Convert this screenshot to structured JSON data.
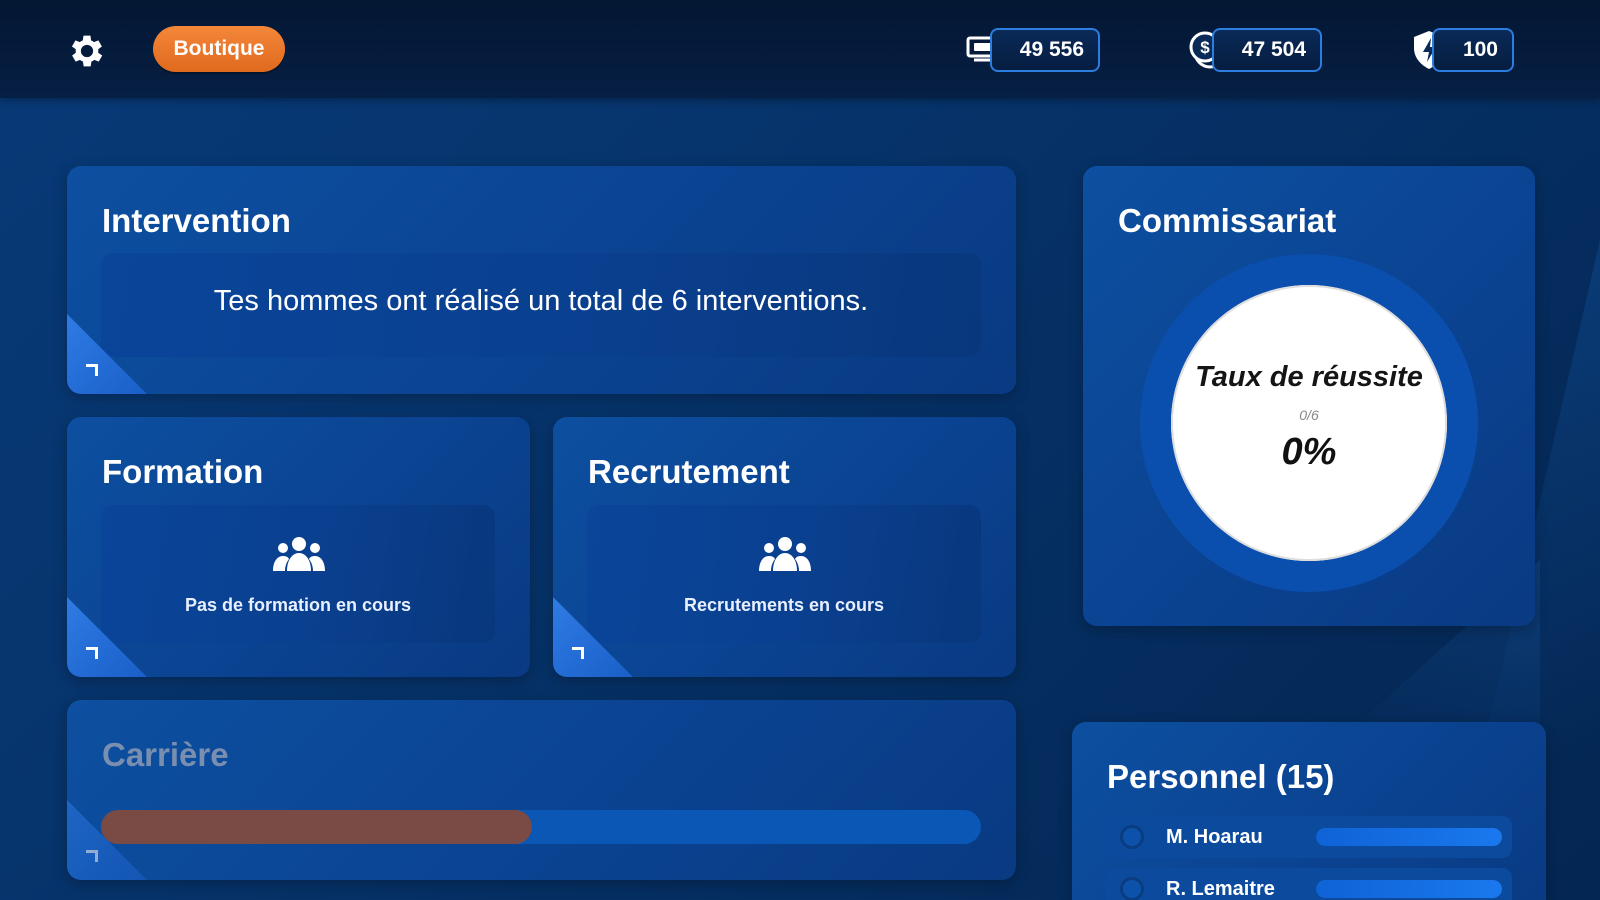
{
  "topbar": {
    "shop_label": "Boutique",
    "resources": [
      {
        "icon": "cash-icon",
        "value": "49 556"
      },
      {
        "icon": "coin-icon",
        "value": "47 504"
      },
      {
        "icon": "energy-shield-icon",
        "value": "100"
      }
    ]
  },
  "intervention": {
    "title": "Intervention",
    "text": "Tes hommes ont réalisé un total de 6 interventions."
  },
  "formation": {
    "title": "Formation",
    "status": "Pas de formation en cours"
  },
  "recrutement": {
    "title": "Recrutement",
    "status": "Recrutements en cours"
  },
  "carriere": {
    "title": "Carrière",
    "progress_fraction": 0.49
  },
  "commissariat": {
    "title": "Commissariat",
    "success_label": "Taux de réussite",
    "ratio": "0/6",
    "percent": "0%"
  },
  "personnel": {
    "title": "Personnel (15)",
    "members": [
      {
        "name": "M. Hoarau",
        "level_fraction": 1.0
      },
      {
        "name": "R. Lemaitre",
        "level_fraction": 1.0
      }
    ]
  },
  "colors": {
    "accent_orange": "#e97626",
    "card_blue": "#0b4a9c",
    "career_fill": "#7a4a44",
    "resource_border": "#2b7de0"
  }
}
